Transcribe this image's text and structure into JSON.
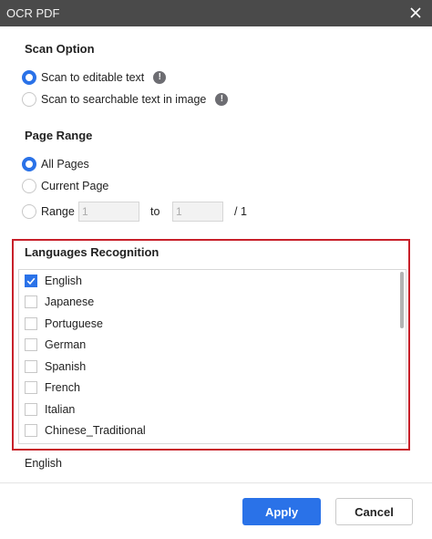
{
  "window": {
    "title": "OCR PDF",
    "close_icon": "close-icon"
  },
  "scan_option": {
    "title": "Scan Option",
    "options": [
      {
        "label": "Scan to editable text",
        "checked": true,
        "info_icon": "info-icon"
      },
      {
        "label": "Scan to searchable text in image",
        "checked": false,
        "info_icon": "info-icon"
      }
    ]
  },
  "page_range": {
    "title": "Page Range",
    "all_pages": "All Pages",
    "current_page": "Current Page",
    "range_label": "Range",
    "range_from": "1",
    "to_label": "to",
    "range_to": "1",
    "total": "/ 1"
  },
  "languages": {
    "title": "Languages Recognition",
    "items": [
      {
        "label": "English",
        "checked": true
      },
      {
        "label": "Japanese",
        "checked": false
      },
      {
        "label": "Portuguese",
        "checked": false
      },
      {
        "label": "German",
        "checked": false
      },
      {
        "label": "Spanish",
        "checked": false
      },
      {
        "label": "French",
        "checked": false
      },
      {
        "label": "Italian",
        "checked": false
      },
      {
        "label": "Chinese_Traditional",
        "checked": false
      }
    ],
    "selected_summary": "English"
  },
  "buttons": {
    "apply": "Apply",
    "cancel": "Cancel"
  },
  "colors": {
    "accent": "#2a72e8",
    "highlight_border": "#c8202a",
    "titlebar": "#4a4a4a"
  }
}
